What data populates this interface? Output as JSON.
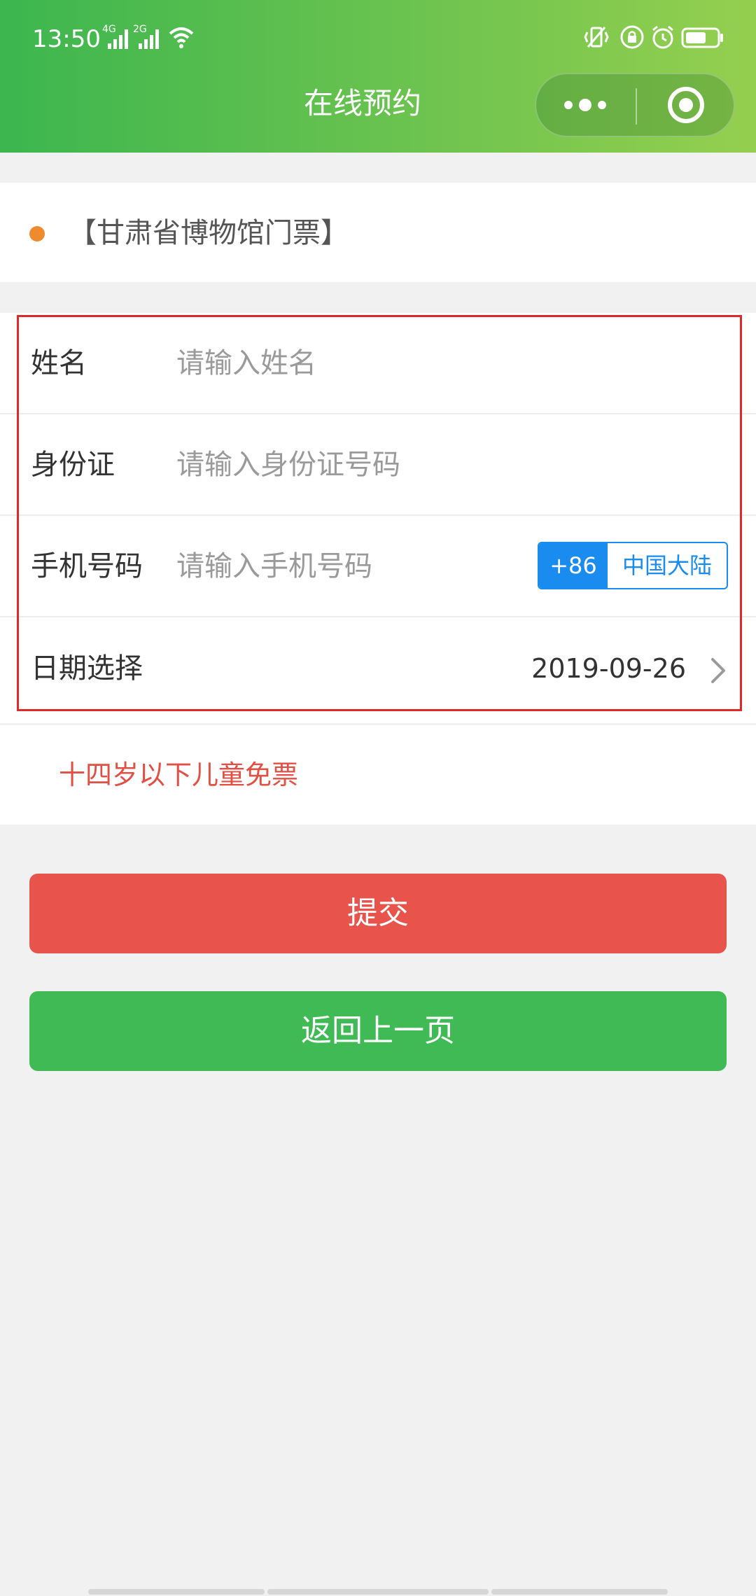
{
  "status_bar": {
    "time": "13:50",
    "signal_1_label": "4G",
    "signal_2_label": "2G",
    "icons": [
      "wifi-icon",
      "vibrate-icon",
      "orientation-lock-icon",
      "alarm-icon",
      "battery-icon"
    ]
  },
  "nav": {
    "title": "在线预约",
    "more_icon": "more-dots-icon",
    "close_icon": "target-circle-icon"
  },
  "ticket": {
    "name": "【甘肃省博物馆门票】",
    "dot_color": "#f08a2f"
  },
  "form": {
    "name": {
      "label": "姓名",
      "placeholder": "请输入姓名",
      "value": ""
    },
    "id_card": {
      "label": "身份证",
      "placeholder": "请输入身份证号码",
      "value": ""
    },
    "phone": {
      "label": "手机号码",
      "placeholder": "请输入手机号码",
      "value": "",
      "country_code": "+86",
      "region": "中国大陆"
    },
    "date": {
      "label": "日期选择",
      "value": "2019-09-26",
      "chevron_icon": "chevron-right-icon"
    }
  },
  "notice": {
    "text": "十四岁以下儿童免票",
    "color": "#e24f44"
  },
  "buttons": {
    "submit": "提交",
    "back": "返回上一页"
  },
  "colors": {
    "header_start": "#3cb64f",
    "header_end": "#95cf4f",
    "submit_bg": "#e8544b",
    "back_bg": "#3fba55",
    "country_code_accent": "#1a8cf0",
    "highlight_border": "#e02828"
  }
}
